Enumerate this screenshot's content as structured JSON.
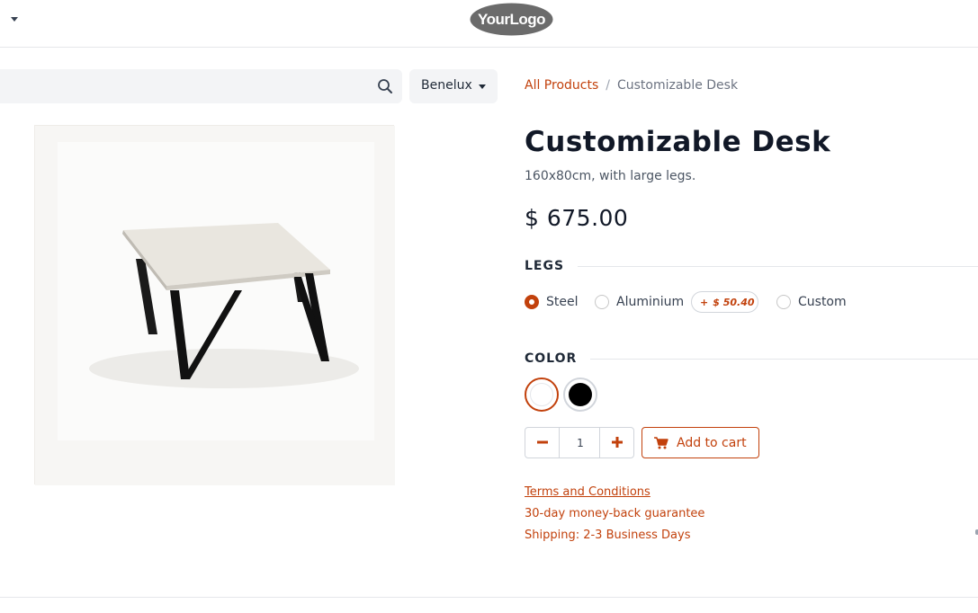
{
  "header": {
    "logo_text": "YourLogo"
  },
  "search": {
    "placeholder": "",
    "pricelist_label": "Benelux"
  },
  "breadcrumb": {
    "parent": "All Products",
    "separator": "/",
    "current": "Customizable Desk"
  },
  "product": {
    "title": "Customizable Desk",
    "description": "160x80cm, with large legs.",
    "price": "$ 675.00",
    "image_alt": "Customizable Desk"
  },
  "attributes": {
    "legs": {
      "label": "LEGS",
      "options": [
        {
          "label": "Steel",
          "selected": true
        },
        {
          "label": "Aluminium",
          "selected": false,
          "extra": "$ 50.40",
          "extra_sign": "+"
        },
        {
          "label": "Custom",
          "selected": false
        }
      ]
    },
    "color": {
      "label": "COLOR",
      "options": [
        {
          "name": "White",
          "hex": "#ffffff",
          "selected": true
        },
        {
          "name": "Black",
          "hex": "#000000",
          "selected": false
        }
      ]
    }
  },
  "cart": {
    "quantity": "1",
    "add_label": "Add to cart"
  },
  "info": {
    "terms": "Terms and Conditions",
    "guarantee": "30-day money-back guarantee",
    "shipping": "Shipping: 2-3 Business Days"
  },
  "colors": {
    "accent": "#c2410c",
    "text": "#374151"
  }
}
